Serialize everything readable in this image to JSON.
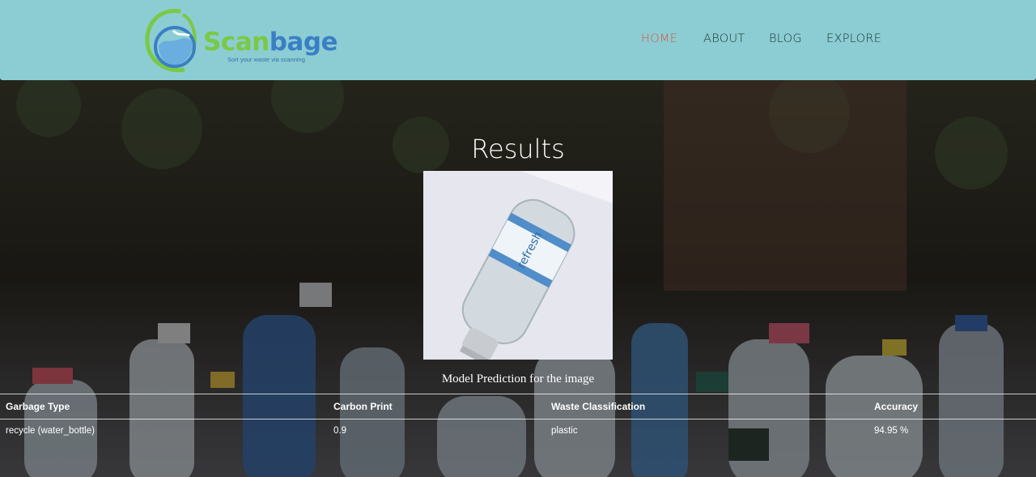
{
  "brand": {
    "name_part1": "Scan",
    "name_part2": "bage",
    "tagline": "Sort your waste via scanning"
  },
  "nav": {
    "items": [
      {
        "label": "HOME",
        "active": true
      },
      {
        "label": "ABOUT",
        "active": false
      },
      {
        "label": "BLOG",
        "active": false
      },
      {
        "label": "EXPLORE",
        "active": false
      }
    ]
  },
  "results": {
    "title": "Results",
    "caption": "Model Prediction for the image",
    "bottle_label": "refresh"
  },
  "table": {
    "headers": [
      "Garbage Type",
      "Carbon Print",
      "Waste Classification",
      "Accuracy"
    ],
    "rows": [
      [
        "recycle (water_bottle)",
        "0.9",
        "plastic",
        "94.95 %"
      ]
    ]
  },
  "colors": {
    "header_bg": "#8bcdd3",
    "nav_active": "#d9534f",
    "brand_green": "#7ac943",
    "brand_blue": "#3a7fc4"
  }
}
